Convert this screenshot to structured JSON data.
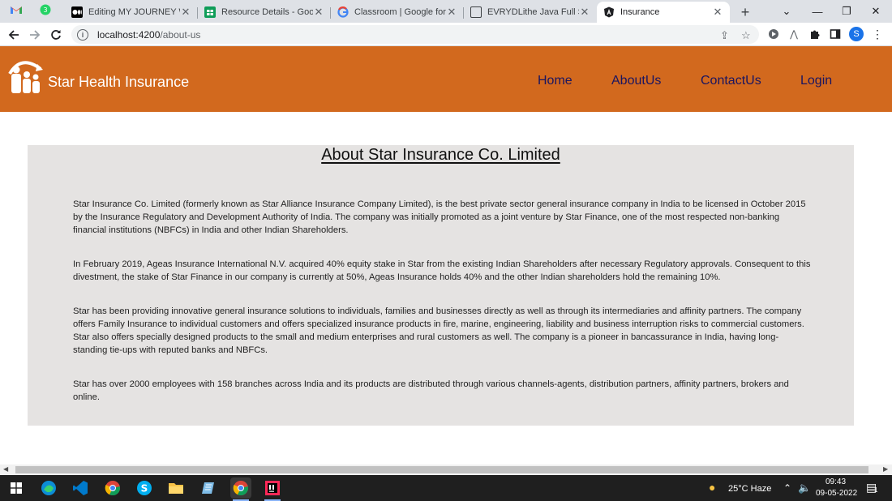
{
  "browser": {
    "tabs": [
      {
        "title": "",
        "icon": "gmail-icon"
      },
      {
        "title": "",
        "icon": "whatsapp-icon"
      },
      {
        "title": "Editing MY JOURNEY WITH",
        "icon": "medium-icon"
      },
      {
        "title": "Resource Details - Google",
        "icon": "sheets-icon"
      },
      {
        "title": "Classroom | Google for Ed",
        "icon": "google-icon"
      },
      {
        "title": "EVRYDLithe Java Full Stack",
        "icon": "doc-icon"
      },
      {
        "title": "Insurance",
        "icon": "angular-icon"
      }
    ],
    "active_tab": 6,
    "url_host": "localhost:4200",
    "url_path": "/about-us",
    "profile_initial": "S"
  },
  "app": {
    "brand": "Star Health Insurance",
    "nav": [
      {
        "label": "Home"
      },
      {
        "label": "AboutUs"
      },
      {
        "label": "ContactUs"
      },
      {
        "label": "Login"
      }
    ],
    "colors": {
      "header": "#d2691e",
      "nav_text": "#1a1560",
      "panel": "#e5e3e2"
    }
  },
  "about": {
    "title": "About Star Insurance Co. Limited",
    "paragraphs": [
      "Star Insurance Co. Limited (formerly known as Star Alliance Insurance Company Limited), is the best private sector general insurance company in India to be licensed in October 2015 by the Insurance Regulatory and Development Authority of India. The company was initially promoted as a joint venture by Star Finance, one of the most respected non-banking financial institutions (NBFCs) in India and other Indian Shareholders.",
      "In February 2019, Ageas Insurance International N.V. acquired 40% equity stake in Star from the existing Indian Shareholders after necessary Regulatory approvals. Consequent to this divestment, the stake of Star Finance in our company is currently at 50%, Ageas Insurance holds 40% and the other Indian shareholders hold the remaining 10%.",
      "Star has been providing innovative general insurance solutions to individuals, families and businesses directly as well as through its intermediaries and affinity partners. The company offers Family Insurance to individual customers and offers specialized insurance products in fire, marine, engineering, liability and business interruption risks to commercial customers. Star also offers specially designed products to the small and medium enterprises and rural customers as well. The company is a pioneer in bancassurance in India, having long-standing tie-ups with reputed banks and NBFCs.",
      "Star has over 2000 employees with 158 branches across India and its products are distributed through various channels-agents, distribution partners, affinity partners, brokers and online."
    ]
  },
  "taskbar": {
    "weather": "25°C  Haze",
    "time": "09:43",
    "date": "09-05-2022",
    "notification_count": "1"
  }
}
